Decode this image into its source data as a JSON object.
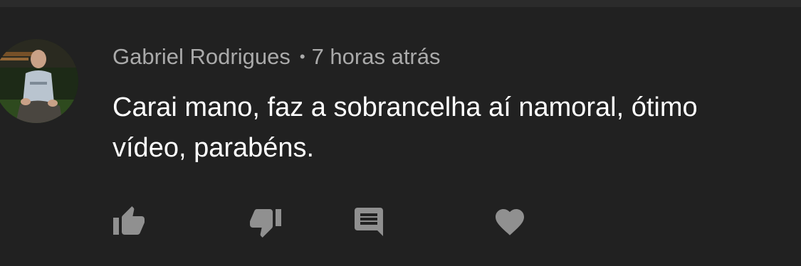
{
  "comment": {
    "author": "Gabriel Rodrigues",
    "separator": "•",
    "timestamp": "7 horas atrás",
    "text": "Carai mano, faz a sobrancelha aí namoral, ótimo vídeo, parabéns.",
    "avatar_icon": "user-avatar-photo"
  },
  "actions": [
    {
      "name": "like",
      "icon": "thumbs-up-icon"
    },
    {
      "name": "dislike",
      "icon": "thumbs-down-icon"
    },
    {
      "name": "reply",
      "icon": "comment-reply-icon"
    },
    {
      "name": "heart",
      "icon": "heart-icon"
    }
  ],
  "colors": {
    "background": "#212121",
    "top_strip": "#2b2b2b",
    "meta_text": "#aaaaaa",
    "body_text": "#ffffff",
    "icon": "#909090"
  }
}
